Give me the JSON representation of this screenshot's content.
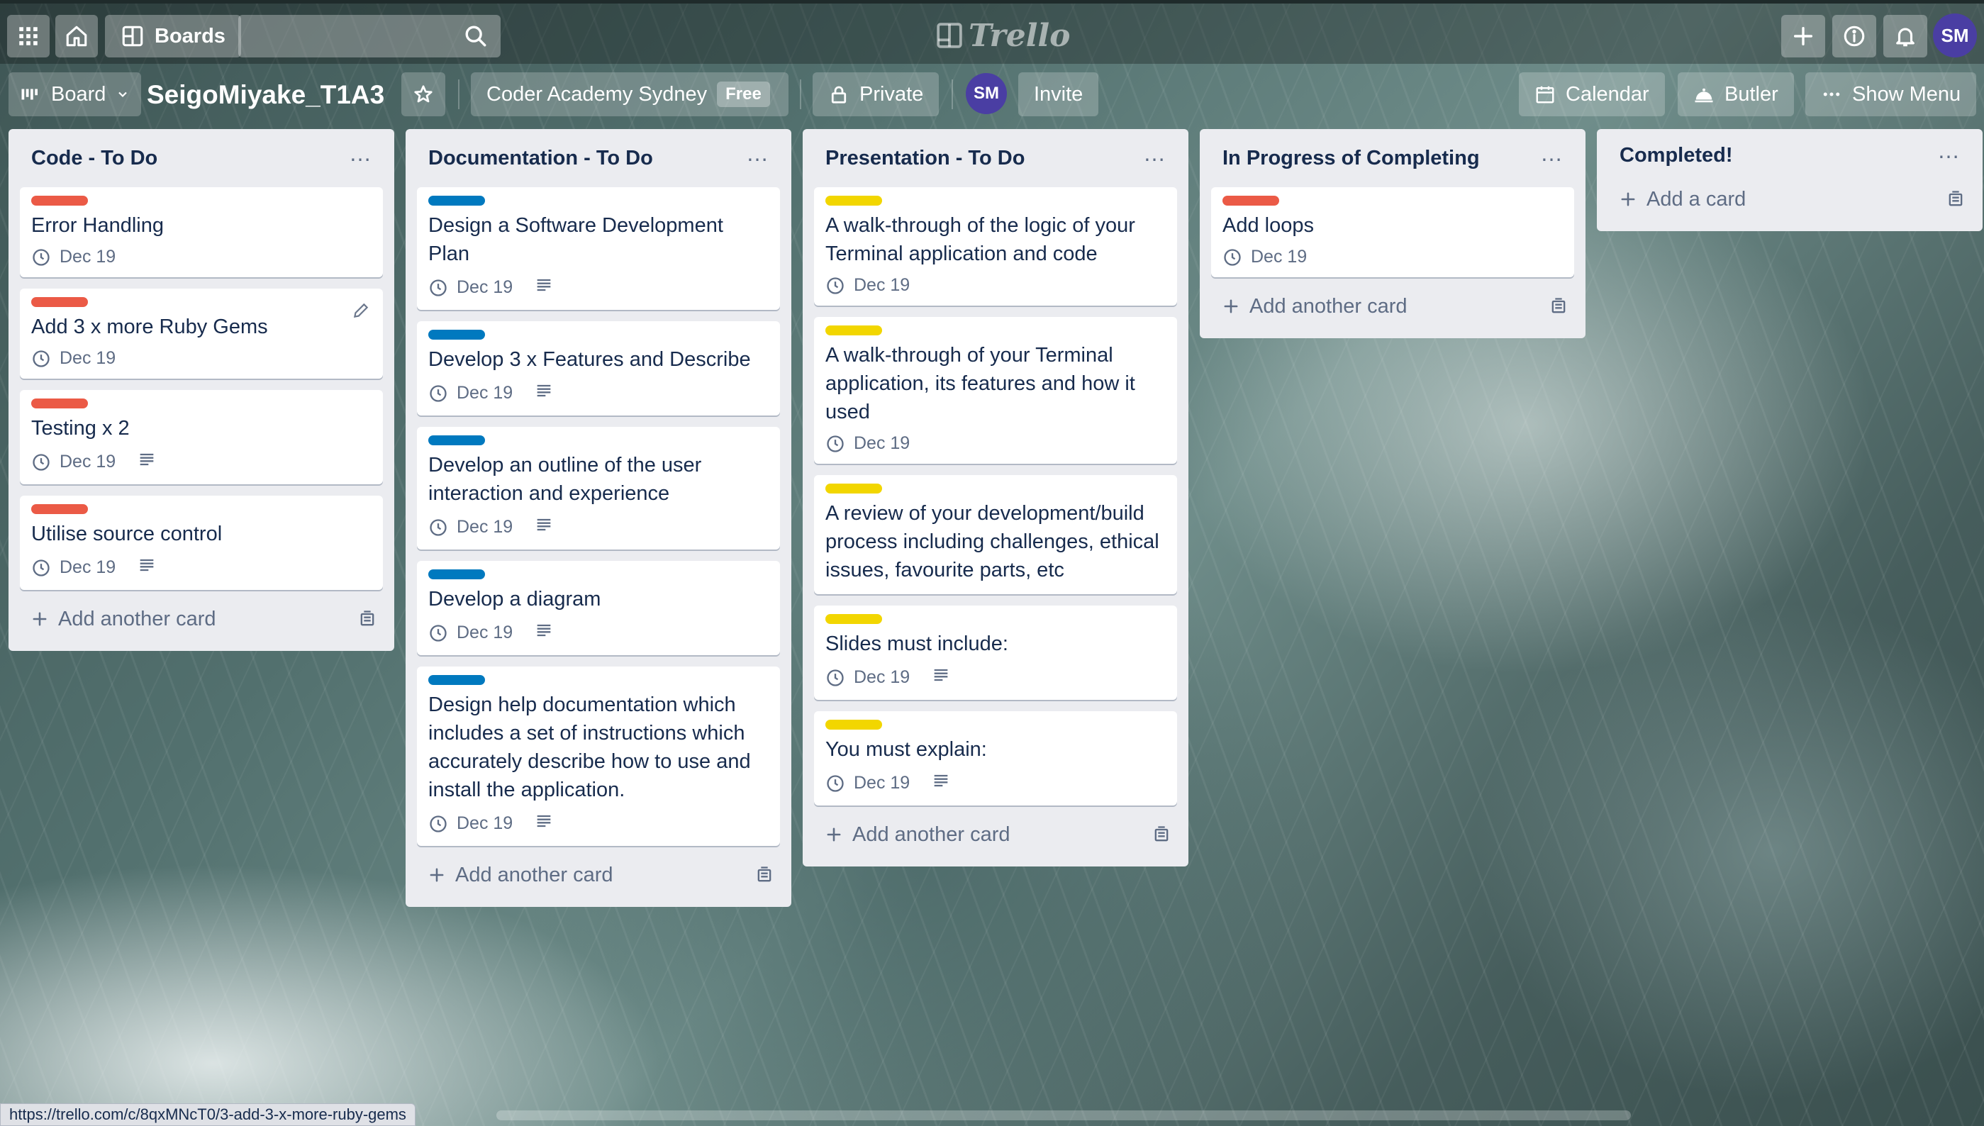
{
  "topbar": {
    "boards_label": "Boards",
    "logo_text": "Trello",
    "user_initials": "SM"
  },
  "board_header": {
    "view_label": "Board",
    "title": "SeigoMiyake_T1A3",
    "team_name": "Coder Academy Sydney",
    "team_badge": "Free",
    "visibility": "Private",
    "member_initials": "SM",
    "invite_label": "Invite",
    "calendar_label": "Calendar",
    "butler_label": "Butler",
    "show_menu_label": "Show Menu"
  },
  "lists": [
    {
      "title": "Code - To Do",
      "add_label": "Add another card",
      "cards": [
        {
          "label": "red",
          "title": "Error Handling",
          "due": "Dec 19",
          "desc": false
        },
        {
          "label": "red",
          "title": "Add 3 x more Ruby Gems",
          "due": "Dec 19",
          "desc": false
        },
        {
          "label": "red",
          "title": "Testing x 2",
          "due": "Dec 19",
          "desc": true
        },
        {
          "label": "red",
          "title": "Utilise source control",
          "due": "Dec 19",
          "desc": true
        }
      ]
    },
    {
      "title": "Documentation - To Do",
      "add_label": "Add another card",
      "cards": [
        {
          "label": "blue",
          "title": "Design a Software Development Plan",
          "due": "Dec 19",
          "desc": true
        },
        {
          "label": "blue",
          "title": "Develop 3 x Features and Describe",
          "due": "Dec 19",
          "desc": true
        },
        {
          "label": "blue",
          "title": "Develop an outline of the user interaction and experience",
          "due": "Dec 19",
          "desc": true
        },
        {
          "label": "blue",
          "title": "Develop a diagram",
          "due": "Dec 19",
          "desc": true
        },
        {
          "label": "blue",
          "title": "Design help documentation which includes a set of instructions which accurately describe how to use and install the application.",
          "due": "Dec 19",
          "desc": true
        }
      ]
    },
    {
      "title": "Presentation - To Do",
      "add_label": "Add another card",
      "cards": [
        {
          "label": "yellow",
          "title": "A walk-through of the logic of your Terminal application and code",
          "due": "Dec 19",
          "desc": false
        },
        {
          "label": "yellow",
          "title": "A walk-through of your Terminal application, its features and how it used",
          "due": "Dec 19",
          "desc": false
        },
        {
          "label": "yellow",
          "title": "A review of your development/build process including challenges, ethical issues, favourite parts, etc",
          "due": null,
          "desc": false
        },
        {
          "label": "yellow",
          "title": "Slides must include:",
          "due": "Dec 19",
          "desc": true
        },
        {
          "label": "yellow",
          "title": "You must explain:",
          "due": "Dec 19",
          "desc": true
        }
      ]
    },
    {
      "title": "In Progress of Completing",
      "add_label": "Add another card",
      "cards": [
        {
          "label": "red",
          "title": "Add loops",
          "due": "Dec 19",
          "desc": false
        }
      ]
    },
    {
      "title": "Completed!",
      "add_label": "Add a card",
      "cards": []
    }
  ],
  "status_bar": {
    "url": "https://trello.com/c/8qxMNcT0/3-add-3-x-more-ruby-gems"
  },
  "colors": {
    "label_red": "#eb5a46",
    "label_blue": "#0079bf",
    "label_yellow": "#f2d600",
    "avatar": "#4a3ea3",
    "list_bg": "#ebecf0"
  },
  "icons": [
    "apps-grid-icon",
    "home-icon",
    "boards-icon",
    "search-icon",
    "plus-icon",
    "info-icon",
    "bell-icon",
    "star-icon",
    "lock-icon",
    "calendar-icon",
    "butler-icon",
    "ellipsis-icon",
    "clock-icon",
    "description-icon",
    "pencil-icon",
    "template-icon"
  ]
}
